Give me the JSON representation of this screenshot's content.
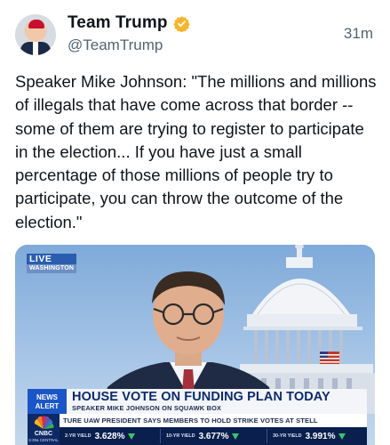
{
  "post": {
    "author": {
      "display_name": "Team Trump",
      "handle": "@TeamTrump",
      "verified_icon": "verified-badge-icon",
      "badge_color": "#f7b52c"
    },
    "timestamp": "31m",
    "text": "Speaker Mike Johnson: \"The millions and millions of illegals that have come across that border -- some of them are trying to register to participate in the election... If you have just a small percentage of those millions of people try to participate, you can throw the outcome of the election.\""
  },
  "media": {
    "live_label": "LIVE",
    "location_label": "WASHINGTON",
    "alert_label_line1": "NEWS",
    "alert_label_line2": "ALERT",
    "headline": "HOUSE VOTE ON FUNDING PLAN TODAY",
    "subheadline": "SPEAKER MIKE JOHNSON ON SQUAWK BOX",
    "network": "CNBC",
    "clock": "6:39a CENTRAL",
    "ticker": "TURE    UAW PRESIDENT SAYS MEMBERS TO HOLD STRIKE VOTES AT STELL",
    "yields": [
      {
        "label": "2-YR YIELD",
        "value": "3.628%"
      },
      {
        "label": "10-YR YIELD",
        "value": "3.677%"
      },
      {
        "label": "30-YR YIELD",
        "value": "3.991%"
      }
    ],
    "accent_color": "#1a56c7",
    "ticker_bg": "#0a1f4d"
  }
}
